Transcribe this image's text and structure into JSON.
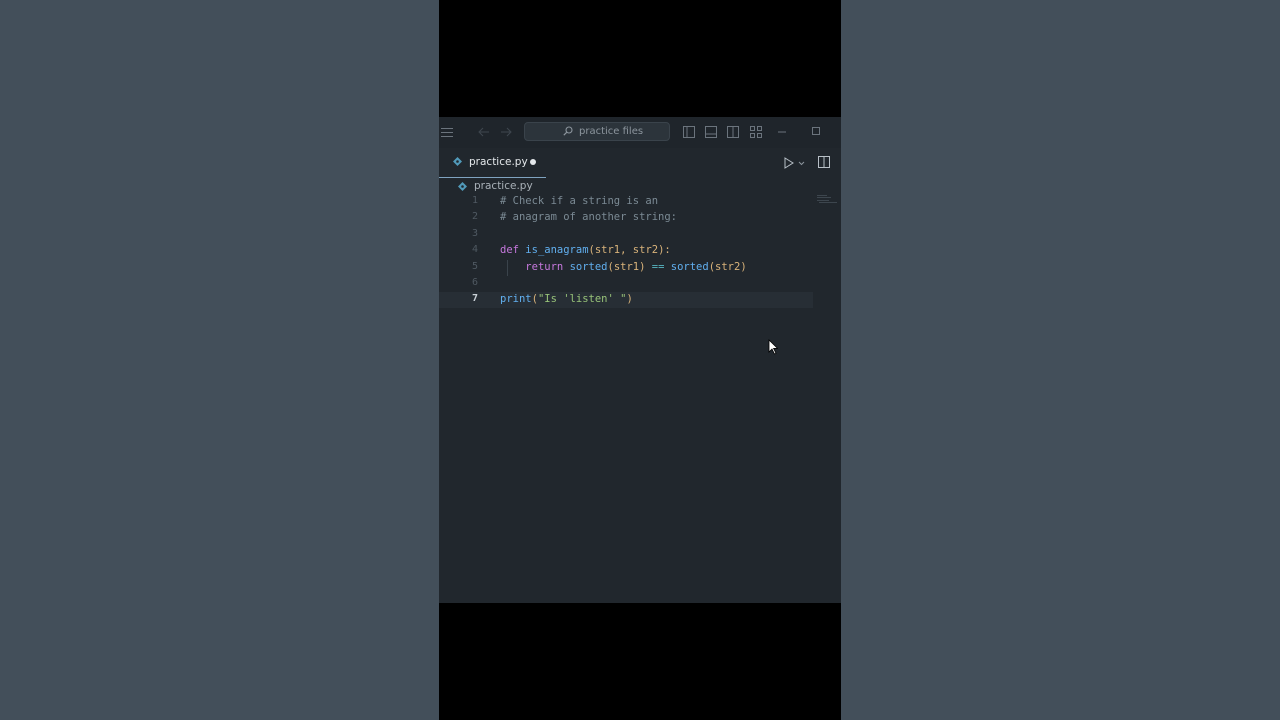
{
  "titlebar": {
    "search_placeholder": "practice files"
  },
  "tab": {
    "label": "practice.py",
    "modified": true
  },
  "breadcrumb": {
    "file": "practice.py"
  },
  "editor": {
    "active_line": 7,
    "lines": [
      {
        "number": "1",
        "text": "# Check if a string is an"
      },
      {
        "number": "2",
        "text": "# anagram of another string:"
      },
      {
        "number": "3",
        "text": ""
      },
      {
        "number": "4",
        "text": "def is_anagram(str1, str2):"
      },
      {
        "number": "5",
        "text": "    return sorted(str1) == sorted(str2)"
      },
      {
        "number": "6",
        "text": ""
      },
      {
        "number": "7",
        "text": "print(\"Is 'listen' \")"
      }
    ]
  },
  "colors": {
    "background": "#434f5a",
    "editor_bg": "#21272d",
    "keyword": "#c678dd",
    "function": "#61afef",
    "string": "#98c379",
    "comment": "#7b8a94"
  },
  "icons": [
    "menu-icon",
    "back-arrow-icon",
    "forward-arrow-icon",
    "search-icon",
    "toggle-primary-sidebar-icon",
    "toggle-panel-icon",
    "toggle-secondary-sidebar-icon",
    "customize-layout-icon",
    "minimize-icon",
    "maximize-icon",
    "python-file-icon",
    "run-icon",
    "split-editor-icon",
    "mouse-cursor-icon"
  ]
}
